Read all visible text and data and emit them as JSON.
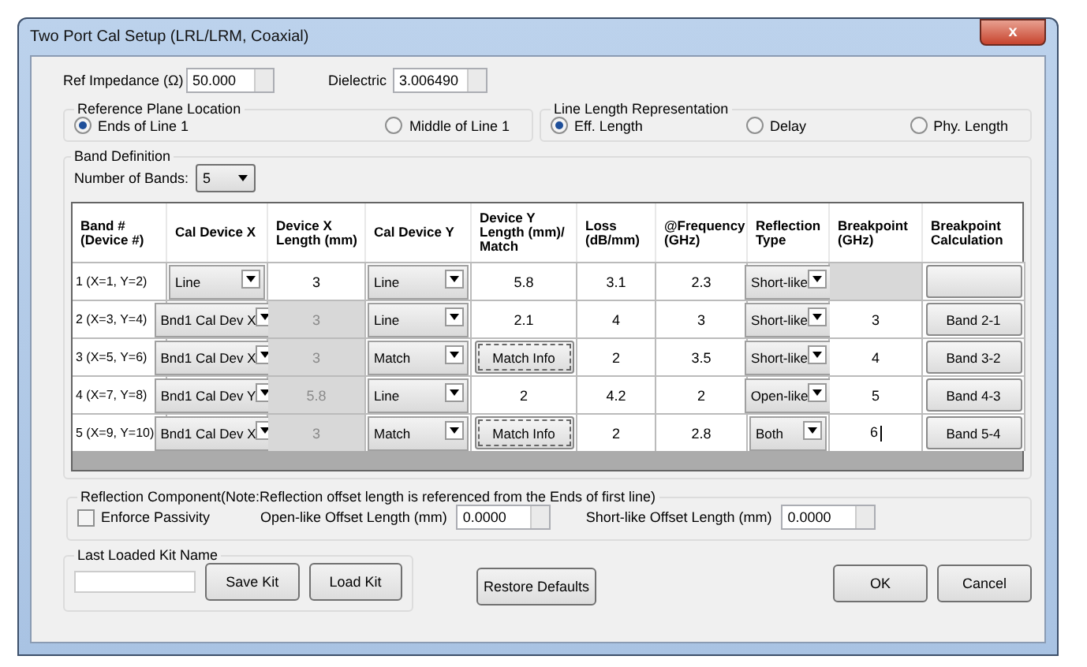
{
  "window": {
    "title": "Two Port Cal Setup (LRL/LRM, Coaxial)",
    "close": "x"
  },
  "ref_impedance": {
    "label": "Ref Impedance (Ω)",
    "value": "50.000"
  },
  "dielectric": {
    "label": "Dielectric",
    "value": "3.006490"
  },
  "reference_plane": {
    "title": "Reference Plane Location",
    "options": [
      {
        "label": "Ends of Line 1",
        "selected": true
      },
      {
        "label": "Middle of Line 1",
        "selected": false
      }
    ]
  },
  "line_length": {
    "title": "Line Length Representation",
    "options": [
      {
        "label": "Eff. Length",
        "selected": true
      },
      {
        "label": "Delay",
        "selected": false
      },
      {
        "label": "Phy. Length",
        "selected": false
      }
    ]
  },
  "band_definition": {
    "title": "Band Definition",
    "bands_label": "Number of Bands:",
    "bands_value": "5",
    "columns": [
      "Band #\n(Device #)",
      "Cal Device X",
      "Device X\nLength (mm)",
      "Cal Device Y",
      "Device Y\nLength (mm)/\nMatch",
      "Loss\n(dB/mm)",
      "@Frequency\n(GHz)",
      "Reflection\nType",
      "Breakpoint\n(GHz)",
      "Breakpoint\nCalculation"
    ],
    "rows": [
      [
        {
          "kind": "label",
          "value": "1 (X=1, Y=2)"
        },
        {
          "kind": "dropdown",
          "value": "Line"
        },
        {
          "kind": "number",
          "value": "3",
          "disabled": false
        },
        {
          "kind": "dropdown",
          "value": "Line"
        },
        {
          "kind": "number",
          "value": "5.8",
          "disabled": false
        },
        {
          "kind": "number",
          "value": "3.1",
          "disabled": false
        },
        {
          "kind": "number",
          "value": "2.3",
          "disabled": false
        },
        {
          "kind": "dropdown",
          "value": "Short-like"
        },
        {
          "kind": "number",
          "disabled": true
        },
        {
          "kind": "button"
        }
      ],
      [
        {
          "kind": "label",
          "value": "2 (X=3, Y=4)"
        },
        {
          "kind": "dropdown",
          "value": "Bnd1 Cal Dev X"
        },
        {
          "kind": "number",
          "value": "3",
          "disabled": true
        },
        {
          "kind": "dropdown",
          "value": "Line"
        },
        {
          "kind": "number",
          "value": "2.1",
          "disabled": false
        },
        {
          "kind": "number",
          "value": "4",
          "disabled": false
        },
        {
          "kind": "number",
          "value": "3",
          "disabled": false
        },
        {
          "kind": "dropdown",
          "value": "Short-like"
        },
        {
          "kind": "number",
          "value": "3",
          "disabled": false
        },
        {
          "kind": "button",
          "value": "Band 2-1"
        }
      ],
      [
        {
          "kind": "label",
          "value": "3 (X=5, Y=6)"
        },
        {
          "kind": "dropdown",
          "value": "Bnd1 Cal Dev X"
        },
        {
          "kind": "number",
          "value": "3",
          "disabled": true
        },
        {
          "kind": "dropdown",
          "value": "Match"
        },
        {
          "kind": "match",
          "value": "Match Info"
        },
        {
          "kind": "number",
          "value": "2",
          "disabled": false
        },
        {
          "kind": "number",
          "value": "3.5",
          "disabled": false
        },
        {
          "kind": "dropdown",
          "value": "Short-like"
        },
        {
          "kind": "number",
          "value": "4",
          "disabled": false
        },
        {
          "kind": "button",
          "value": "Band 3-2"
        }
      ],
      [
        {
          "kind": "label",
          "value": "4 (X=7, Y=8)"
        },
        {
          "kind": "dropdown",
          "value": "Bnd1 Cal Dev Y"
        },
        {
          "kind": "number",
          "value": "5.8",
          "disabled": true
        },
        {
          "kind": "dropdown",
          "value": "Line"
        },
        {
          "kind": "number",
          "value": "2",
          "disabled": false
        },
        {
          "kind": "number",
          "value": "4.2",
          "disabled": false
        },
        {
          "kind": "number",
          "value": "2",
          "disabled": false
        },
        {
          "kind": "dropdown",
          "value": "Open-like"
        },
        {
          "kind": "number",
          "value": "5",
          "disabled": false
        },
        {
          "kind": "button",
          "value": "Band 4-3"
        }
      ],
      [
        {
          "kind": "label",
          "value": "5 (X=9, Y=10)"
        },
        {
          "kind": "dropdown",
          "value": "Bnd1 Cal Dev X"
        },
        {
          "kind": "number",
          "value": "3",
          "disabled": true
        },
        {
          "kind": "dropdown",
          "value": "Match"
        },
        {
          "kind": "match",
          "value": "Match Info"
        },
        {
          "kind": "number",
          "value": "2",
          "disabled": false
        },
        {
          "kind": "number",
          "value": "2.8",
          "disabled": false
        },
        {
          "kind": "dropdown",
          "value": "Both"
        },
        {
          "kind": "number",
          "value": "6",
          "disabled": false,
          "editing": true
        },
        {
          "kind": "button",
          "value": "Band 5-4"
        }
      ]
    ]
  },
  "reflection_component": {
    "title": "Reflection Component(Note:Reflection offset length is referenced from the Ends of first line)",
    "enforce_passivity": {
      "label": "Enforce Passivity",
      "checked": false
    },
    "open_offset": {
      "label": "Open-like Offset Length (mm)",
      "value": "0.0000"
    },
    "short_offset": {
      "label": "Short-like Offset Length (mm)",
      "value": "0.0000"
    }
  },
  "kit": {
    "title": "Last Loaded Kit Name",
    "buttons": [
      "Save Kit",
      "Load Kit"
    ]
  },
  "buttons": [
    "Restore Defaults",
    "OK",
    "Cancel"
  ]
}
